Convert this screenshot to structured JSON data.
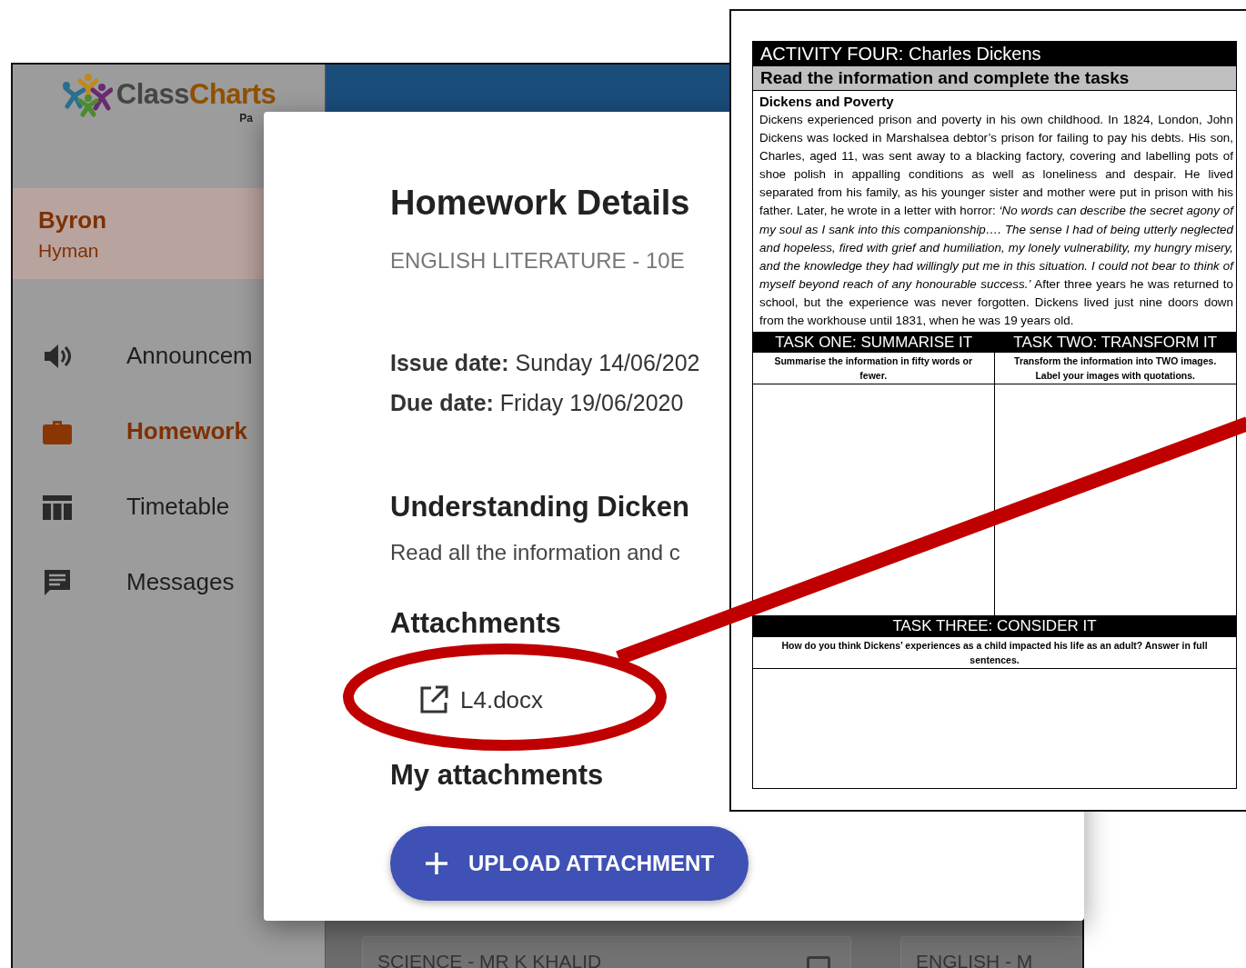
{
  "sidebar": {
    "logo": {
      "text": "Class**Charts**",
      "subtitle": "Pa"
    },
    "profile": {
      "first_name": "Byron",
      "last_name": "Hyman"
    },
    "nav": [
      {
        "label": "Announcem",
        "selected": false
      },
      {
        "label": "Homework",
        "selected": true
      },
      {
        "label": "Timetable",
        "selected": false
      },
      {
        "label": "Messages",
        "selected": false
      }
    ]
  },
  "background_cards": [
    {
      "title": "SCIENCE - MR K KHALID",
      "checked": false
    },
    {
      "title": "ENGLISH - M"
    }
  ],
  "dialog": {
    "title": "Homework Details",
    "subject": "ENGLISH LITERATURE - 10E",
    "dates": [
      "**Issue date:** Sunday 14/06/202",
      "**Due date:** Friday 19/06/2020"
    ],
    "task_title": "Understanding Dicken",
    "task_description": "Read all the information and c",
    "attachments_heading": "Attachments",
    "attachments": [
      {
        "name": "L4.docx"
      }
    ],
    "my_attachments_heading": "My attachments",
    "upload_button": "UPLOAD ATTACHMENT"
  },
  "document": {
    "title": "ACTIVITY FOUR: Charles Dickens",
    "subtitle": "Read the information and complete the tasks",
    "section_title": "Dickens and Poverty",
    "paragraph": "Dickens experienced prison and poverty in his own childhood. In 1824, London, John Dickens was locked in Marshalsea debtor’s prison for failing to pay his debts. His son, Charles, aged 11, was sent away to a blacking factory, covering and labelling pots of shoe polish in appalling conditions as well as loneliness and despair. He lived separated from his family, as his younger sister and mother were put in prison with his father. Later, he wrote in a letter with horror: *‘No words can describe the secret agony of my soul as I sank into this companionship…. The sense I had of being utterly neglected and hopeless, fired with grief and humiliation, my lonely vulnerability, my hungry misery, and the knowledge they had willingly put me in this situation. I could not bear to think of myself beyond reach of any honourable success.’* After three years he was returned to school, but the experience was never forgotten. Dickens lived just nine doors down from the workhouse until 1831, when he was 19 years old.",
    "tasks": [
      {
        "heading": "TASK ONE: SUMMARISE IT",
        "instruction": "Summarise the information in fifty words or fewer."
      },
      {
        "heading": "TASK TWO: TRANSFORM IT",
        "instruction": "Transform the information into TWO images. Label your images with quotations."
      },
      {
        "heading": "TASK THREE: CONSIDER IT",
        "instruction": "How do you think Dickens’ experiences as a child impacted his life as an adult? Answer in full sentences."
      }
    ]
  }
}
